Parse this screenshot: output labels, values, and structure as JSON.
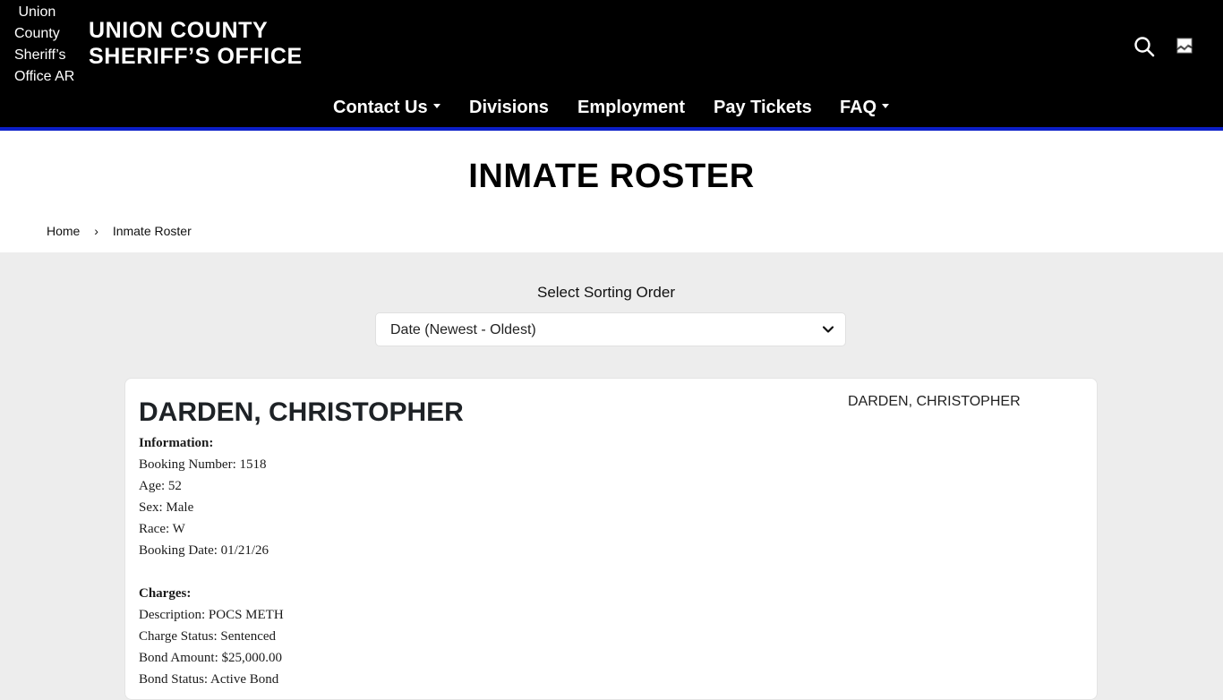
{
  "header": {
    "logo_alt": "Union County Sheriff’s Office AR",
    "title_line1": "UNION COUNTY",
    "title_line2": "SHERIFF’S OFFICE",
    "icons": [
      "search-icon",
      "broken-image-icon"
    ],
    "nav": [
      {
        "label": "Contact Us",
        "has_dropdown": true
      },
      {
        "label": "Divisions",
        "has_dropdown": false
      },
      {
        "label": "Employment",
        "has_dropdown": false
      },
      {
        "label": "Pay Tickets",
        "has_dropdown": false
      },
      {
        "label": "FAQ",
        "has_dropdown": true
      }
    ]
  },
  "page": {
    "title": "INMATE ROSTER",
    "breadcrumb": {
      "home": "Home",
      "separator": "›",
      "current": "Inmate Roster"
    }
  },
  "sorting": {
    "label": "Select Sorting Order",
    "selected": "Date (Newest - Oldest)"
  },
  "inmate": {
    "name": "DARDEN, CHRISTOPHER",
    "photo_alt": "DARDEN, CHRISTOPHER",
    "information_heading": "Information:",
    "booking_number": "Booking Number: 1518",
    "age": "Age: 52",
    "sex": "Sex: Male",
    "race": "Race: W",
    "booking_date": "Booking Date: 01/21/26",
    "charges_heading": "Charges:",
    "description": "Description: POCS METH",
    "charge_status": "Charge Status: Sentenced",
    "bond_amount": "Bond Amount: $25,000.00",
    "bond_status": "Bond Status: Active Bond"
  },
  "colors": {
    "header_bg": "#000000",
    "accent_bar": "#0c1fc9",
    "page_bg": "#ededed"
  }
}
